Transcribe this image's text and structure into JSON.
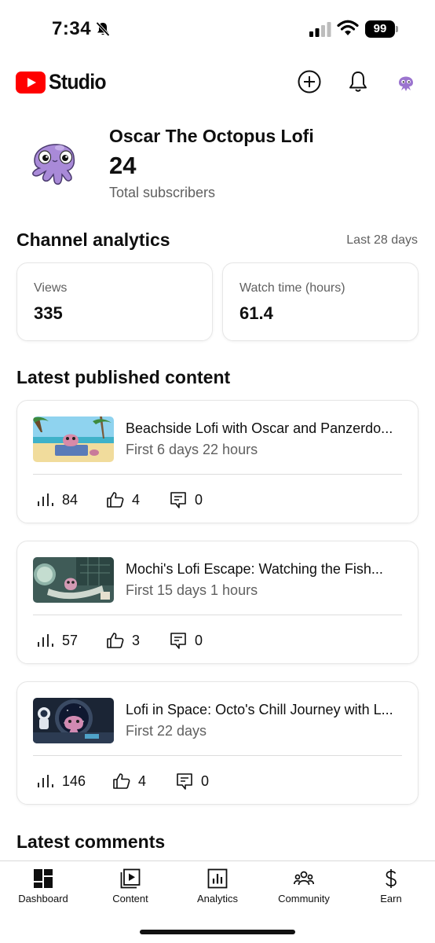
{
  "status_bar": {
    "time": "7:34",
    "battery": "99"
  },
  "header": {
    "logo_text": "Studio",
    "brand_color": "#ff0000"
  },
  "channel": {
    "name": "Oscar The Octopus Lofi",
    "subscriber_count": "24",
    "subscriber_label": "Total subscribers"
  },
  "analytics": {
    "title": "Channel analytics",
    "range": "Last 28 days",
    "views_label": "Views",
    "views_value": "335",
    "watch_label": "Watch time (hours)",
    "watch_value": "61.4"
  },
  "latest_content": {
    "title": "Latest published content",
    "videos": [
      {
        "title": "Beachside Lofi with Oscar and Panzerdo...",
        "age": "First 6 days 22 hours",
        "views": "84",
        "likes": "4",
        "comments": "0"
      },
      {
        "title": "Mochi's Lofi Escape: Watching the Fish...",
        "age": "First 15 days 1 hours",
        "views": "57",
        "likes": "3",
        "comments": "0"
      },
      {
        "title": "Lofi in Space: Octo's Chill Journey with L...",
        "age": "First 22 days",
        "views": "146",
        "likes": "4",
        "comments": "0"
      }
    ]
  },
  "comments": {
    "title": "Latest comments"
  },
  "nav": {
    "items": [
      {
        "label": "Dashboard",
        "icon": "dashboard-icon"
      },
      {
        "label": "Content",
        "icon": "content-icon"
      },
      {
        "label": "Analytics",
        "icon": "analytics-icon"
      },
      {
        "label": "Community",
        "icon": "community-icon"
      },
      {
        "label": "Earn",
        "icon": "earn-icon"
      }
    ]
  }
}
